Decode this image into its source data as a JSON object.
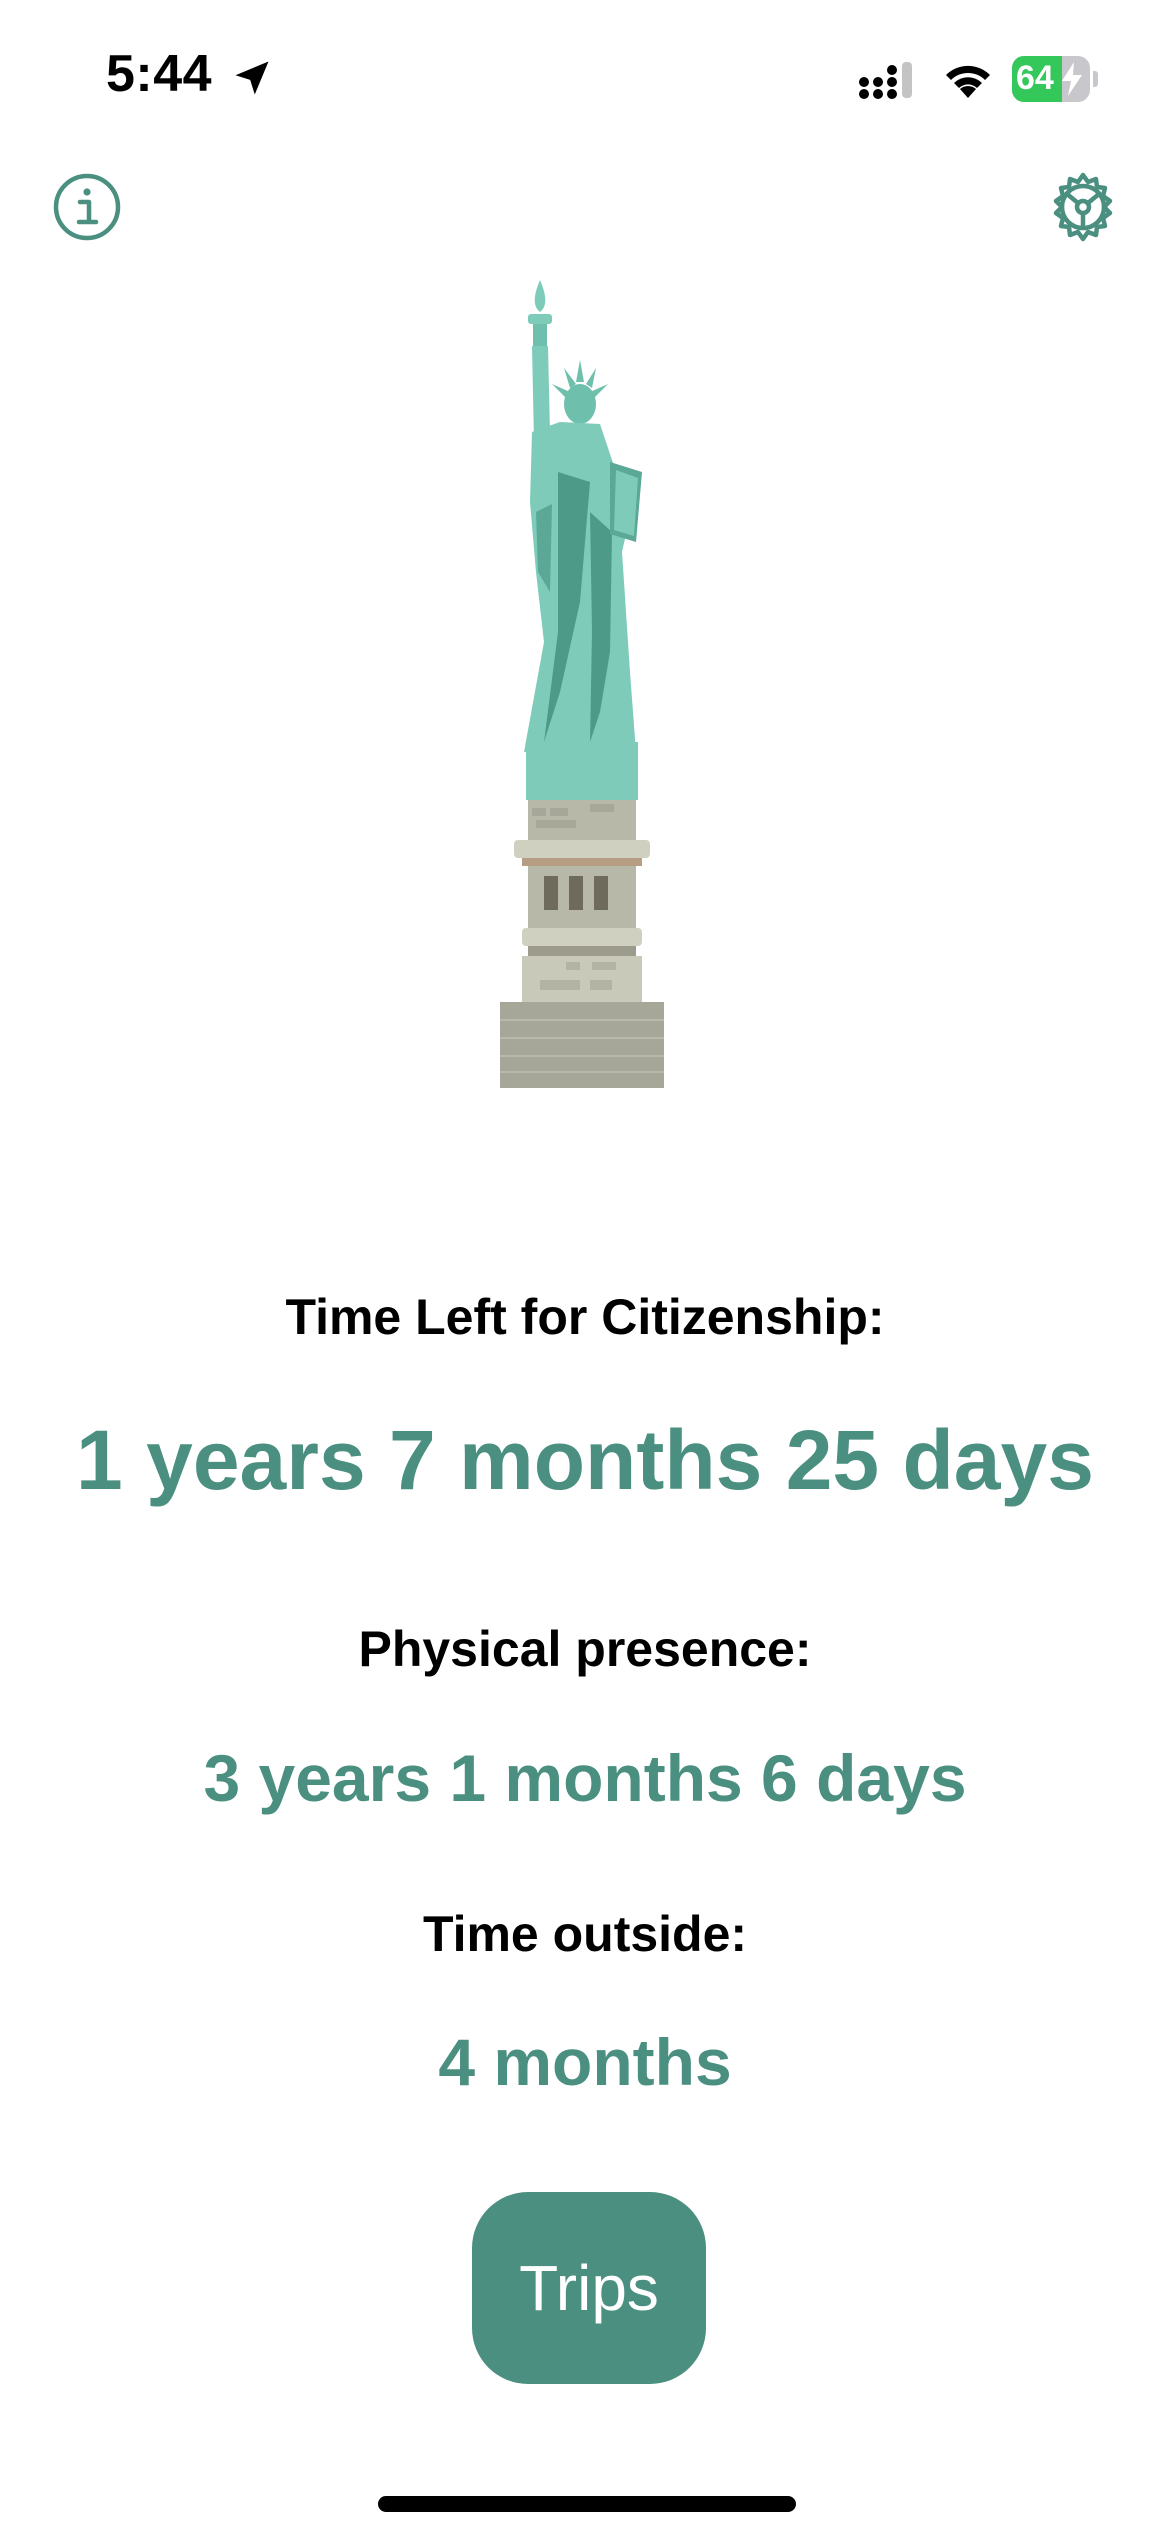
{
  "status_bar": {
    "time": "5:44",
    "battery_level": "64",
    "battery_charging": true
  },
  "toolbar": {
    "info_icon": "info-circle-icon",
    "settings_icon": "gear-icon"
  },
  "illustration": {
    "subject": "statue-of-liberty",
    "colors": {
      "statue": "#7ecbb9",
      "statue_shadow": "#4e9a88",
      "pedestal": "#b8b9aa"
    }
  },
  "summary": {
    "time_left_label": "Time Left for Citizenship:",
    "time_left_value": "1 years 7 months 25 days",
    "presence_label": "Physical presence:",
    "presence_value": "3 years 1 months 6 days",
    "outside_label": "Time outside:",
    "outside_value": "4 months"
  },
  "actions": {
    "trips_label": "Trips"
  },
  "colors": {
    "accent": "#4a8f80",
    "battery_green": "#34c759"
  }
}
